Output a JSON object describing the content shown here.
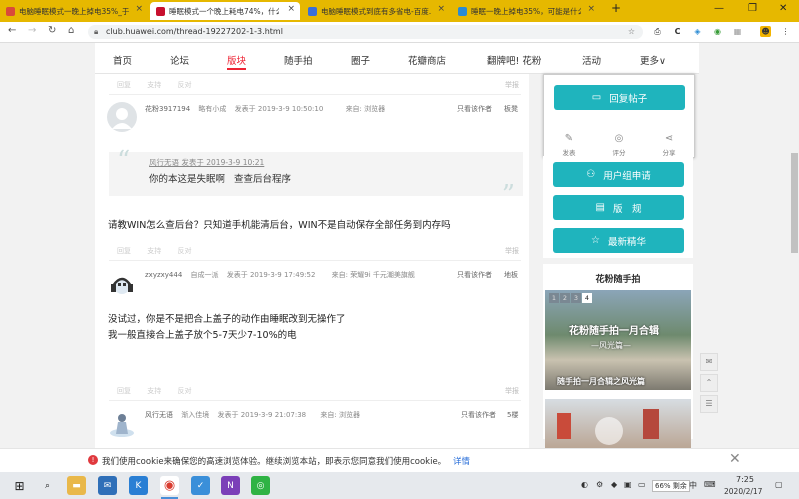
{
  "tabs": [
    {
      "title": "电脑睡眠模式一晚上掉电35%_于…",
      "favicon_color": "#d94a3a"
    },
    {
      "title": "睡眠模式一个晚上耗电74%，什么…",
      "favicon_color": "#c8102e",
      "active": true
    },
    {
      "title": "电脑睡眠模式到底有多省电-百度…",
      "favicon_color": "#3a6fd9"
    },
    {
      "title": "睡眠一晚上掉电35%，可能是什么…",
      "favicon_color": "#2a8bd4"
    }
  ],
  "browser": {
    "url": "club.huawei.com/thread-19227202-1-3.html",
    "new_tab": "+"
  },
  "site_nav": [
    {
      "label": "首页"
    },
    {
      "label": "论坛"
    },
    {
      "label": "版块",
      "active": true
    },
    {
      "label": "随手拍"
    },
    {
      "label": "圈子"
    },
    {
      "label": "花瓣商店"
    },
    {
      "label": "翻牌吧! 花粉"
    },
    {
      "label": "活动"
    },
    {
      "label": "更多∨"
    }
  ],
  "post_actions": {
    "reply": "回复",
    "support": "支持",
    "oppose": "反对",
    "report": "举报"
  },
  "posts": [
    {
      "author": "花粉3917194",
      "level": "略有小成",
      "posted": "发表于 2019-3-9 10:50:10",
      "source": "来自: 浏览器",
      "only_author": "只看该作者",
      "floor": "板凳",
      "quote_head": "风行无语 发表于 2019-3-9 10:21",
      "quote_body": "你的本这是失眠啊   查查后台程序",
      "body": [
        "请教WIN怎么查后台？只知道手机能清后台，WIN不是自动保存全部任务到内存吗"
      ]
    },
    {
      "author": "zxyzxy444",
      "level": "自成一派",
      "posted": "发表于 2019-3-9 17:49:52",
      "source": "来自: 荣耀9i 千元潮美旗舰",
      "only_author": "只看该作者",
      "floor": "地板",
      "body": [
        "没试过，你是不是把合上盖子的动作由睡眠改到无操作了",
        "我一般直接合上盖子放个5-7天少7-10%的电"
      ]
    },
    {
      "author": "风行无语",
      "level": "渐入佳境",
      "posted": "发表于 2019-3-9 21:07:38",
      "source": "来自: 浏览器",
      "only_author": "只看该作者",
      "floor": "5楼"
    }
  ],
  "sidebar": {
    "reply_button": "回复帖子",
    "sub_actions": [
      "发表",
      "评分",
      "分享"
    ],
    "group_button": "用户组申请",
    "rules_button": "版　规",
    "featured_button": "最新精华",
    "gallery_title": "花粉随手拍",
    "gallery_pages": [
      "1",
      "2",
      "3",
      "4"
    ],
    "gallery_active_page": "4",
    "photo_overlay_1": "花粉随手拍一月合辑",
    "photo_overlay_2": "—风光篇—",
    "photo_caption": "随手拍一月合辑之风光篇"
  },
  "cookie_bar": {
    "text": "我们使用cookie来确保您的高速浏览体验。继续浏览本站，即表示您同意我们使用cookie。",
    "link": "详情"
  },
  "taskbar": {
    "battery": "66% 剩余",
    "ime": "中",
    "time": "7:25",
    "date": "2020/2/17"
  }
}
